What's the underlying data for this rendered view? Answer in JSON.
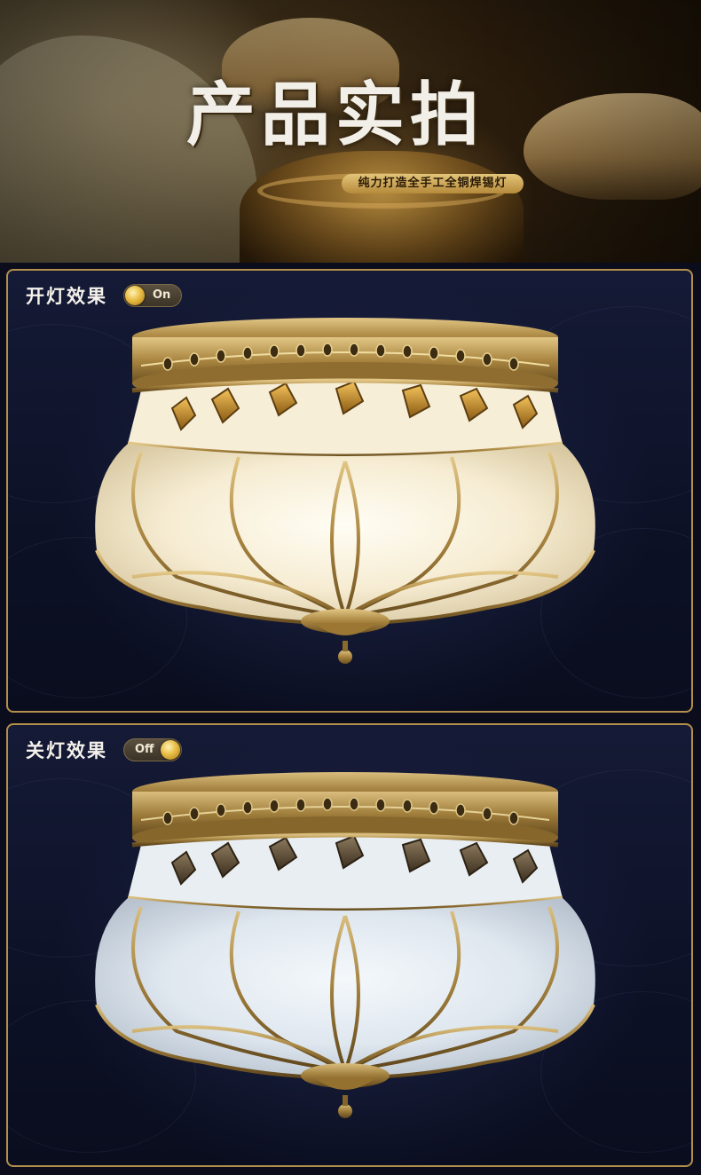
{
  "hero": {
    "title": "产品实拍",
    "subtitle": "纯力打造全手工全铜焊锡灯"
  },
  "panels": {
    "on": {
      "label": "开灯效果",
      "toggle_text": "On",
      "state": "lit"
    },
    "off": {
      "label": "关灯效果",
      "toggle_text": "Off",
      "state": "unlit"
    }
  },
  "colors": {
    "frame_gold": "#b48f4c",
    "panel_navy": "#0d1126",
    "brass": "#b8924a",
    "glass_lit": "#fbf4e2",
    "glass_unlit": "#e7eef5"
  }
}
